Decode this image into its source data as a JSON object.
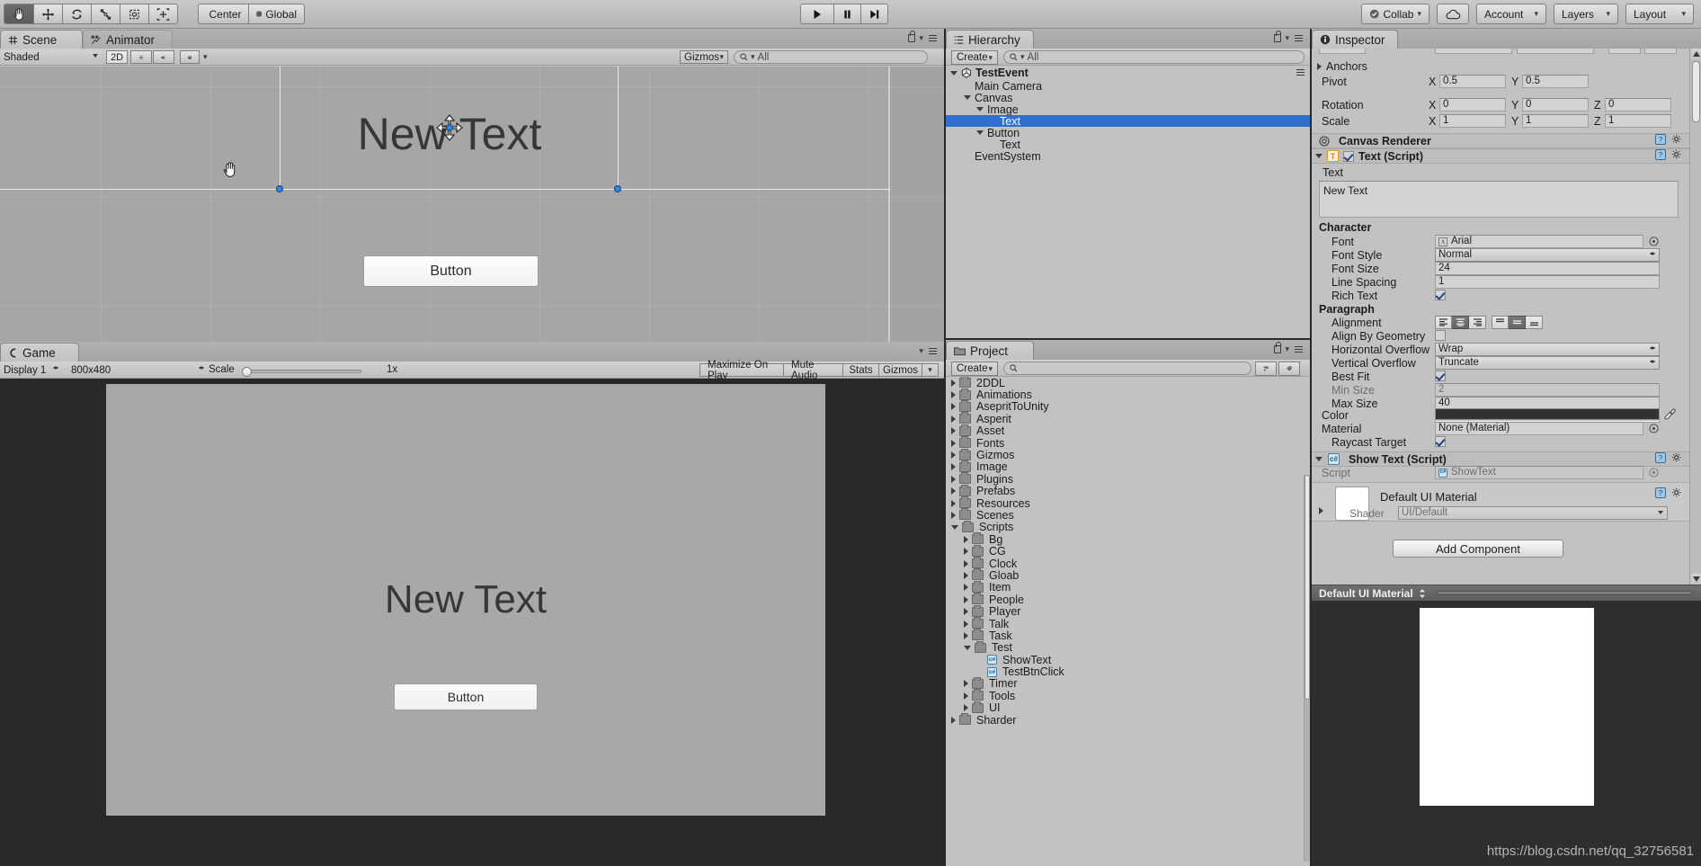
{
  "toolbar": {
    "tools": [
      "hand-tool",
      "move-tool",
      "rotate-tool",
      "scale-tool",
      "rect-tool",
      "transform-tool"
    ],
    "pivot_mode": "Center",
    "pivot_rotation": "Global",
    "play": "play-icon",
    "pause": "pause-icon",
    "step": "step-icon",
    "collab": "Collab",
    "cloud": "cloud-icon",
    "account": "Account",
    "layers": "Layers",
    "layout": "Layout"
  },
  "scene_panel": {
    "tabs": [
      {
        "label": "Scene",
        "icon": "scene-icon",
        "active": true
      },
      {
        "label": "Animator",
        "icon": "animator-icon",
        "active": false
      }
    ],
    "draw_mode": "Shaded",
    "two_d": "2D",
    "lighting_icon": "lighting-icon",
    "audio_icon": "audio-icon",
    "fx_icon": "effects-icon",
    "gizmos": "Gizmos",
    "search_placeholder": "All",
    "search_value": "",
    "canvas": {
      "text_label": "New Text",
      "button_label": "Button",
      "cursor": "hand-cursor",
      "move_gizmo": "move-gizmo"
    }
  },
  "game_panel": {
    "tab": {
      "label": "Game",
      "icon": "game-icon"
    },
    "display": "Display 1",
    "resolution": "800x480",
    "scale_label": "Scale",
    "scale_value": "1x",
    "maximize_on_play": "Maximize On Play",
    "mute_audio": "Mute Audio",
    "stats": "Stats",
    "gizmos": "Gizmos",
    "canvas": {
      "text_label": "New Text",
      "button_label": "Button"
    }
  },
  "hierarchy": {
    "tab": {
      "label": "Hierarchy",
      "icon": "hierarchy-icon"
    },
    "create": "Create",
    "search_placeholder": "All",
    "search_value": "",
    "scene_name": "TestEvent",
    "items": [
      {
        "label": "Main Camera",
        "depth": 1,
        "arrow": "none",
        "selected": false
      },
      {
        "label": "Canvas",
        "depth": 1,
        "arrow": "open",
        "selected": false
      },
      {
        "label": "Image",
        "depth": 2,
        "arrow": "open",
        "selected": false
      },
      {
        "label": "Text",
        "depth": 3,
        "arrow": "none",
        "selected": true
      },
      {
        "label": "Button",
        "depth": 2,
        "arrow": "open",
        "selected": false
      },
      {
        "label": "Text",
        "depth": 3,
        "arrow": "none",
        "selected": false
      },
      {
        "label": "EventSystem",
        "depth": 1,
        "arrow": "none",
        "selected": false
      }
    ]
  },
  "project": {
    "tab": {
      "label": "Project",
      "icon": "project-icon"
    },
    "create": "Create",
    "search_placeholder": "",
    "search_value": "",
    "items": [
      {
        "label": "2DDL",
        "depth": 0,
        "type": "folder",
        "arrow": "closed"
      },
      {
        "label": "Animations",
        "depth": 0,
        "type": "folder",
        "arrow": "closed"
      },
      {
        "label": "AsepritToUnity",
        "depth": 0,
        "type": "folder",
        "arrow": "closed"
      },
      {
        "label": "Asperit",
        "depth": 0,
        "type": "folder",
        "arrow": "closed"
      },
      {
        "label": "Asset",
        "depth": 0,
        "type": "folder",
        "arrow": "closed"
      },
      {
        "label": "Fonts",
        "depth": 0,
        "type": "folder",
        "arrow": "closed"
      },
      {
        "label": "Gizmos",
        "depth": 0,
        "type": "folder",
        "arrow": "closed"
      },
      {
        "label": "Image",
        "depth": 0,
        "type": "folder",
        "arrow": "closed"
      },
      {
        "label": "Plugins",
        "depth": 0,
        "type": "folder",
        "arrow": "closed"
      },
      {
        "label": "Prefabs",
        "depth": 0,
        "type": "folder",
        "arrow": "closed"
      },
      {
        "label": "Resources",
        "depth": 0,
        "type": "folder",
        "arrow": "closed"
      },
      {
        "label": "Scenes",
        "depth": 0,
        "type": "folder",
        "arrow": "closed"
      },
      {
        "label": "Scripts",
        "depth": 0,
        "type": "folder",
        "arrow": "open"
      },
      {
        "label": "Bg",
        "depth": 1,
        "type": "folder",
        "arrow": "closed"
      },
      {
        "label": "CG",
        "depth": 1,
        "type": "folder",
        "arrow": "closed"
      },
      {
        "label": "Clock",
        "depth": 1,
        "type": "folder",
        "arrow": "closed"
      },
      {
        "label": "Gloab",
        "depth": 1,
        "type": "folder",
        "arrow": "closed"
      },
      {
        "label": "Item",
        "depth": 1,
        "type": "folder",
        "arrow": "closed"
      },
      {
        "label": "People",
        "depth": 1,
        "type": "folder",
        "arrow": "closed"
      },
      {
        "label": "Player",
        "depth": 1,
        "type": "folder",
        "arrow": "closed"
      },
      {
        "label": "Talk",
        "depth": 1,
        "type": "folder",
        "arrow": "closed"
      },
      {
        "label": "Task",
        "depth": 1,
        "type": "folder",
        "arrow": "closed"
      },
      {
        "label": "Test",
        "depth": 1,
        "type": "folder",
        "arrow": "open"
      },
      {
        "label": "ShowText",
        "depth": 2,
        "type": "script",
        "arrow": "none"
      },
      {
        "label": "TestBtnClick",
        "depth": 2,
        "type": "script",
        "arrow": "none"
      },
      {
        "label": "Timer",
        "depth": 1,
        "type": "folder",
        "arrow": "closed"
      },
      {
        "label": "Tools",
        "depth": 1,
        "type": "folder",
        "arrow": "closed"
      },
      {
        "label": "UI",
        "depth": 1,
        "type": "folder",
        "arrow": "closed"
      },
      {
        "label": "Sharder",
        "depth": 0,
        "type": "folder",
        "arrow": "closed"
      }
    ]
  },
  "inspector": {
    "tab": {
      "label": "Inspector",
      "icon": "inspector-icon"
    },
    "rect_transform": {
      "anchors_label": "Anchors",
      "pivot_label": "Pivot",
      "pivot_x_label": "X",
      "pivot_x": "0.5",
      "pivot_y_label": "Y",
      "pivot_y": "0.5",
      "rotation_label": "Rotation",
      "rot_x_label": "X",
      "rot_x": "0",
      "rot_y_label": "Y",
      "rot_y": "0",
      "rot_z_label": "Z",
      "rot_z": "0",
      "scale_label": "Scale",
      "scale_x_label": "X",
      "scale_x": "1",
      "scale_y_label": "Y",
      "scale_y": "1",
      "scale_z_label": "Z",
      "scale_z": "1"
    },
    "canvas_renderer": {
      "title": "Canvas Renderer"
    },
    "text_component": {
      "title": "Text (Script)",
      "enabled": true,
      "text_label": "Text",
      "text_value": "New Text",
      "character_header": "Character",
      "font_label": "Font",
      "font_value": "Arial",
      "font_style_label": "Font Style",
      "font_style_value": "Normal",
      "font_size_label": "Font Size",
      "font_size_value": "24",
      "line_spacing_label": "Line Spacing",
      "line_spacing_value": "1",
      "rich_text_label": "Rich Text",
      "rich_text_value": true,
      "paragraph_header": "Paragraph",
      "alignment_label": "Alignment",
      "align_h_selected": 1,
      "align_v_selected": 1,
      "align_by_geometry_label": "Align By Geometry",
      "align_by_geometry_value": false,
      "horizontal_overflow_label": "Horizontal Overflow",
      "horizontal_overflow_value": "Wrap",
      "vertical_overflow_label": "Vertical Overflow",
      "vertical_overflow_value": "Truncate",
      "best_fit_label": "Best Fit",
      "best_fit_value": true,
      "min_size_label": "Min Size",
      "min_size_value": "2",
      "max_size_label": "Max Size",
      "max_size_value": "40",
      "color_label": "Color",
      "color_value": "#323232",
      "material_label": "Material",
      "material_value": "None (Material)",
      "raycast_target_label": "Raycast Target",
      "raycast_target_value": true
    },
    "show_text_component": {
      "title": "Show Text (Script)",
      "script_label": "Script",
      "script_value": "ShowText"
    },
    "material_component": {
      "title": "Default UI Material",
      "shader_label": "Shader",
      "shader_value": "UI/Default"
    },
    "add_component": "Add Component",
    "preview": {
      "title": "Default UI Material"
    }
  },
  "watermark": "https://blog.csdn.net/qq_32756581",
  "colors": {
    "selection_blue": "#2f6fd0",
    "chrome": "#c2c2c2",
    "dark": "#282828",
    "scene_bg": "#a0a0a0",
    "game_bg": "#a8a8a8"
  }
}
